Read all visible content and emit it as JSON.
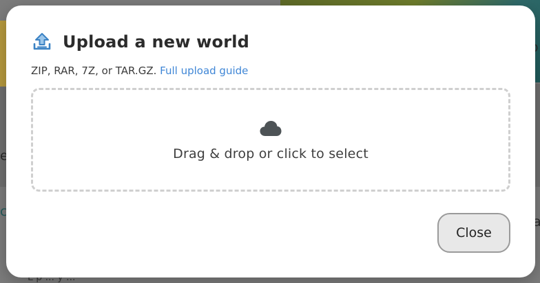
{
  "background": {
    "fragments": [
      "o",
      "e",
      "c",
      "a",
      "L  p  ...  y  ..."
    ]
  },
  "modal": {
    "header_icon": "upload-icon",
    "title": "Upload a new world",
    "formats_text": "ZIP, RAR, 7Z, or TAR.GZ.",
    "guide_link": "Full upload guide",
    "dropzone": {
      "icon": "cloud-icon",
      "label": "Drag & drop or click to select"
    },
    "close_label": "Close"
  },
  "colors": {
    "accent_link": "#3f86d6",
    "icon_blue": "#3b82c4"
  }
}
